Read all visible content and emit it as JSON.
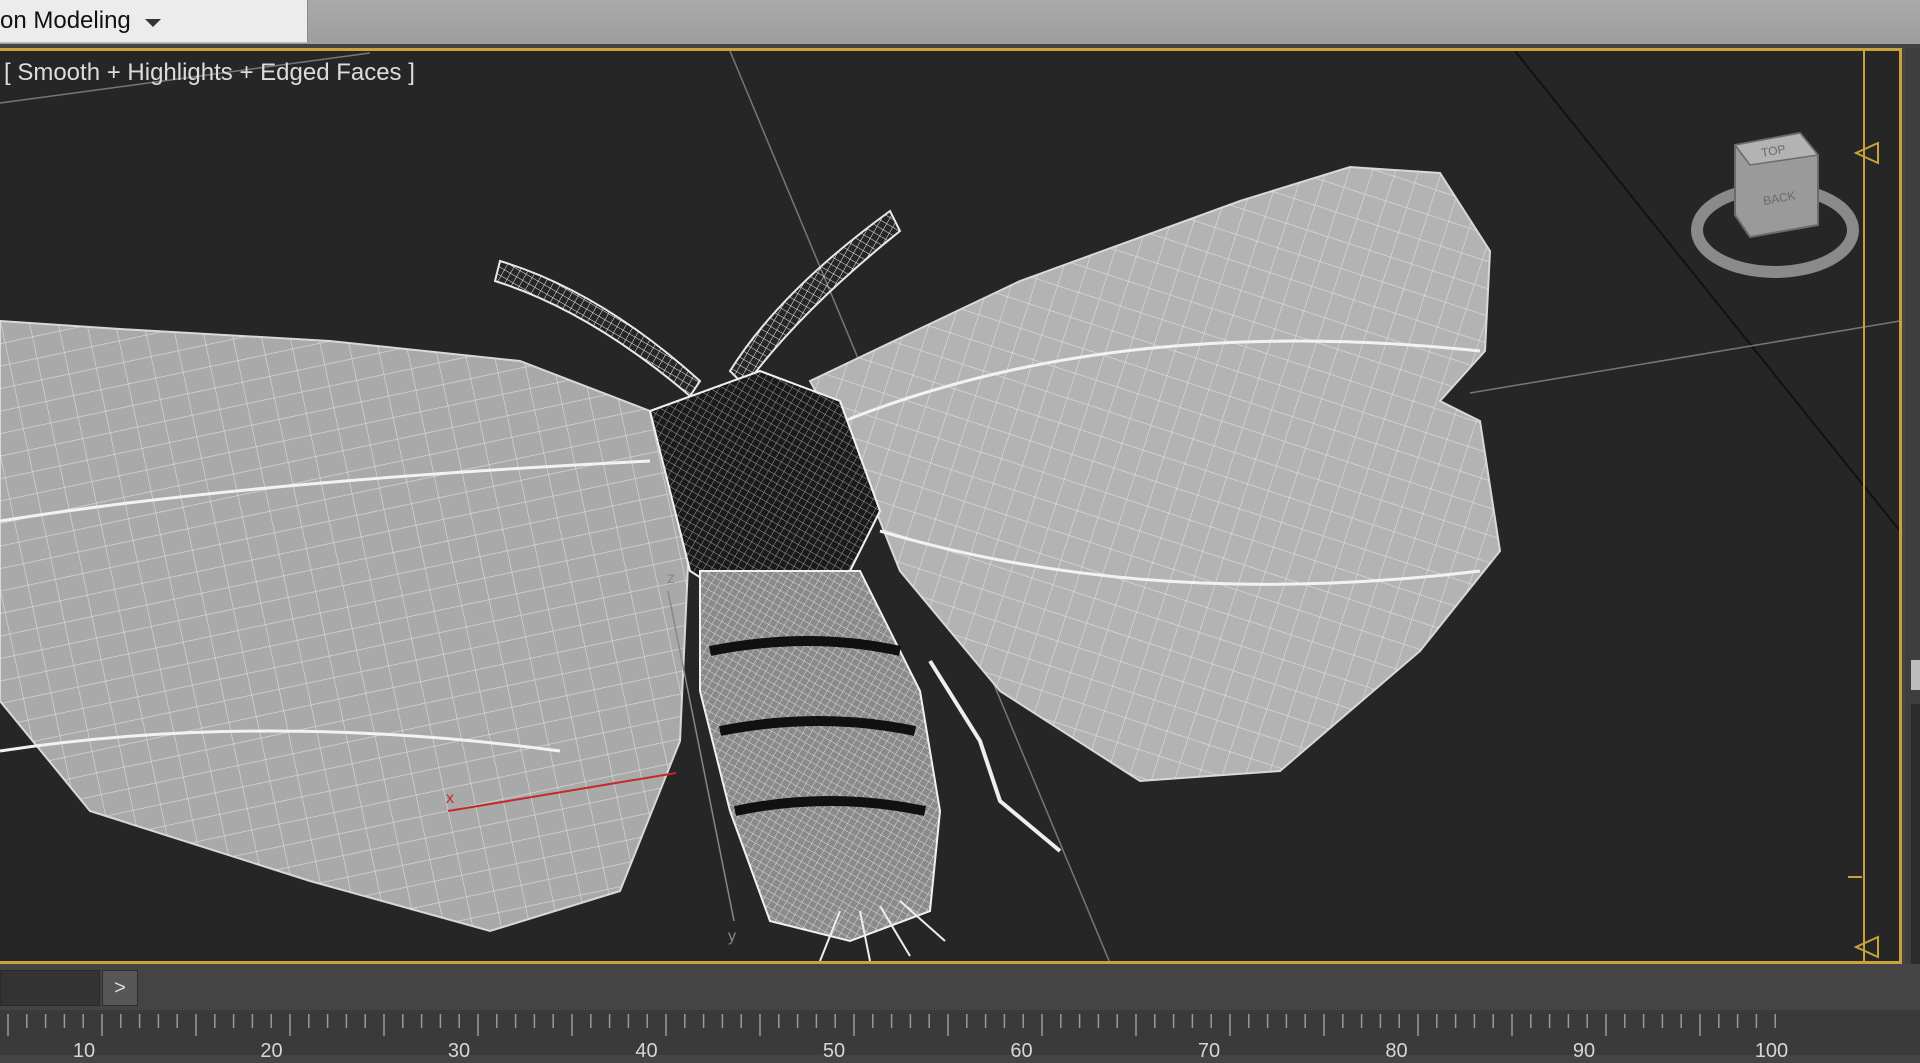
{
  "ribbon": {
    "tab_label": "on Modeling"
  },
  "viewport": {
    "label": "[ Smooth + Highlights + Edged Faces ]",
    "axis_labels": {
      "x": "x",
      "y": "y",
      "z": "z"
    },
    "viewcube": {
      "top_face": "TOP",
      "side_face": "BACK"
    }
  },
  "timeline": {
    "next_label": ">",
    "tick_labels": [
      "10",
      "20",
      "30",
      "40",
      "50",
      "60",
      "70",
      "80",
      "90",
      "100"
    ]
  },
  "colors": {
    "viewport_border": "#c8a23a",
    "viewport_bg": "#262626",
    "x_axis": "#c62828"
  }
}
